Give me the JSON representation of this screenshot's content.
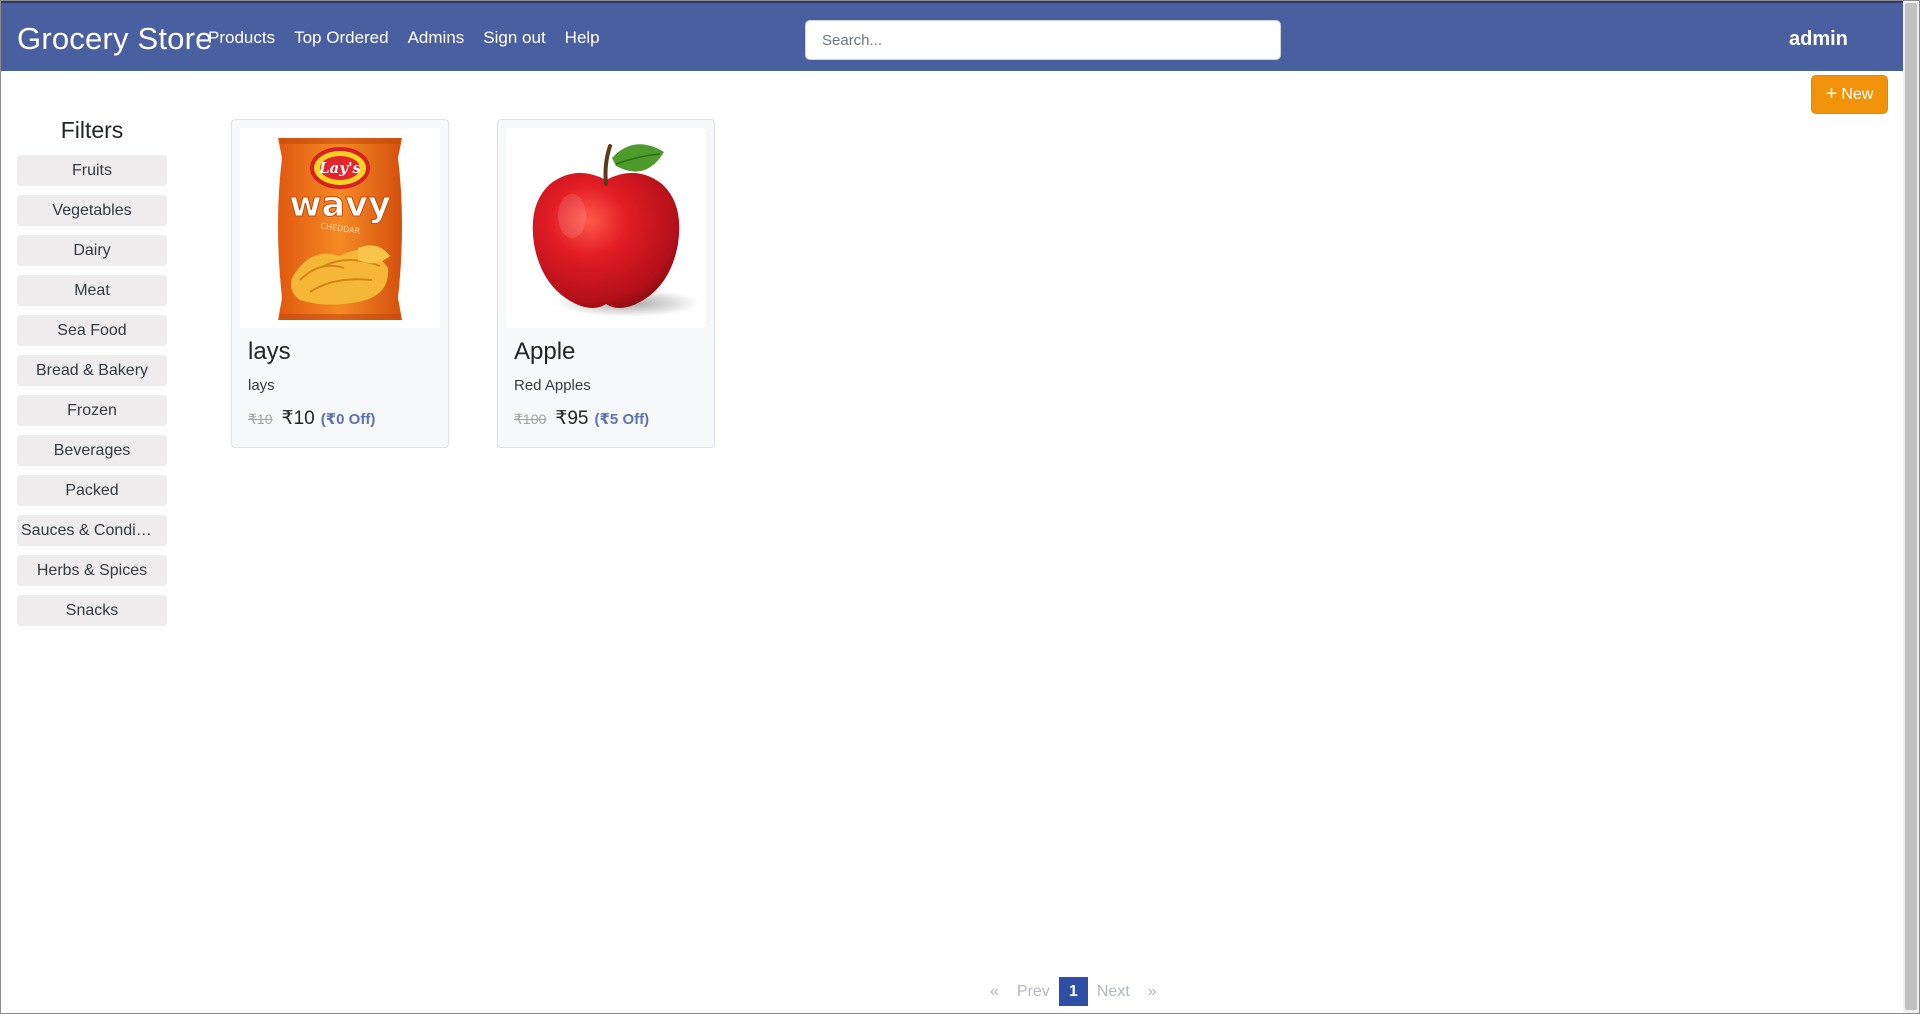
{
  "navbar": {
    "brand": "Grocery Store",
    "links": [
      "Products",
      "Top Ordered",
      "Admins",
      "Sign out",
      "Help"
    ],
    "search_placeholder": "Search...",
    "user": "admin"
  },
  "toolbar": {
    "new_label": "New",
    "new_icon": "plus-icon",
    "new_color": "#f0930a"
  },
  "filters": {
    "title": "Filters",
    "items": [
      "Fruits",
      "Vegetables",
      "Dairy",
      "Meat",
      "Sea Food",
      "Bread & Bakery",
      "Frozen",
      "Beverages",
      "Packed",
      "Sauces & Condiments",
      "Herbs & Spices",
      "Snacks"
    ]
  },
  "products": [
    {
      "title": "lays",
      "description": "lays",
      "old_price": "₹10",
      "price": "₹10",
      "discount": "(₹0 Off)",
      "image": "lays-wavy-chips-bag"
    },
    {
      "title": "Apple",
      "description": "Red Apples",
      "old_price": "₹100",
      "price": "₹95",
      "discount": "(₹5 Off)",
      "image": "red-apple"
    }
  ],
  "pagination": {
    "first": "«",
    "prev": "Prev",
    "current": "1",
    "next": "Next",
    "last": "»"
  },
  "theme": {
    "navbar_color": "#4a5fa0",
    "accent": "#f0930a",
    "discount_color": "#5d72b3",
    "active_page_color": "#2f4fa6"
  }
}
